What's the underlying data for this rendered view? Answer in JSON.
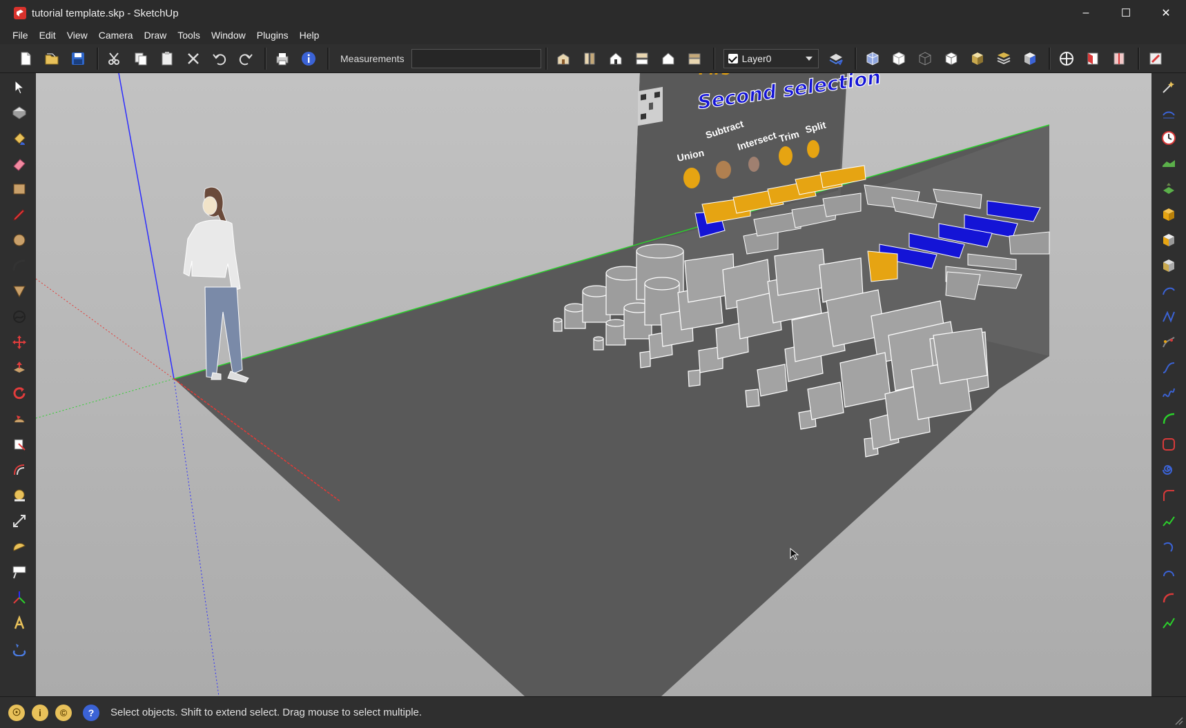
{
  "window": {
    "title": "tutorial template.skp - SketchUp",
    "minimize": "–",
    "maximize": "☐",
    "close": "✕"
  },
  "menu": [
    "File",
    "Edit",
    "View",
    "Camera",
    "Draw",
    "Tools",
    "Window",
    "Plugins",
    "Help"
  ],
  "toolbar": {
    "measurements_label": "Measurements",
    "measurements_value": "",
    "layer": {
      "checked": true,
      "name": "Layer0"
    }
  },
  "viewport": {
    "board": {
      "title_fragment": "Firs",
      "title": "Second selection",
      "labels": [
        "Union",
        "Subtract",
        "Intersect",
        "Trim",
        "Split"
      ]
    }
  },
  "status": {
    "text": "Select objects. Shift to extend select. Drag mouse to select multiple."
  },
  "colors": {
    "chrome": "#2b2b2b",
    "sky": "#b9b9b9",
    "ground": "#5b5b5b",
    "selection_blue": "#1414d6",
    "orange": "#e6a412",
    "red_axis": "#e53935",
    "green_axis": "#2bd12b",
    "blue_axis": "#2c2cff"
  }
}
